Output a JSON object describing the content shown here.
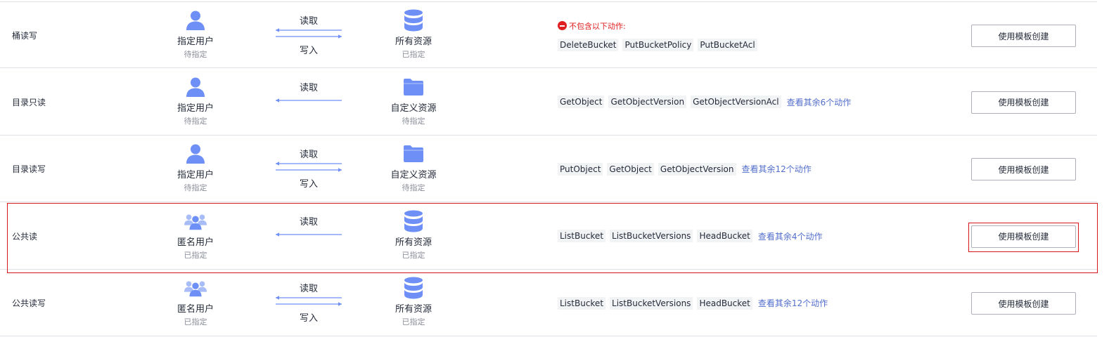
{
  "colors": {
    "accent": "#526ecc",
    "icon": "#6e8ff5",
    "danger": "#e02020",
    "highlight": "#d9161c"
  },
  "rows": [
    {
      "name": "桶读写",
      "principal": {
        "icon": "user-icon",
        "title": "指定用户",
        "status": "待指定"
      },
      "read_label": "读取",
      "write_label": "写入",
      "resource": {
        "icon": "database-icon",
        "title": "所有资源",
        "status": "已指定"
      },
      "exclude_label": "不包含以下动作:",
      "tags": [
        "DeleteBucket",
        "PutBucketPolicy",
        "PutBucketAcl"
      ],
      "more": "",
      "button": "使用模板创建"
    },
    {
      "name": "目录只读",
      "principal": {
        "icon": "user-icon",
        "title": "指定用户",
        "status": "待指定"
      },
      "read_label": "读取",
      "write_label": "",
      "resource": {
        "icon": "folder-icon",
        "title": "自定义资源",
        "status": "待指定"
      },
      "exclude_label": "",
      "tags": [
        "GetObject",
        "GetObjectVersion",
        "GetObjectVersionAcl"
      ],
      "more": "查看其余6个动作",
      "button": "使用模板创建"
    },
    {
      "name": "目录读写",
      "principal": {
        "icon": "user-icon",
        "title": "指定用户",
        "status": "待指定"
      },
      "read_label": "读取",
      "write_label": "写入",
      "resource": {
        "icon": "folder-icon",
        "title": "自定义资源",
        "status": "待指定"
      },
      "exclude_label": "",
      "tags": [
        "PutObject",
        "GetObject",
        "GetObjectVersion"
      ],
      "more": "查看其余12个动作",
      "button": "使用模板创建"
    },
    {
      "name": "公共读",
      "principal": {
        "icon": "anonymous-users-icon",
        "title": "匿名用户",
        "status": "已指定"
      },
      "read_label": "读取",
      "write_label": "",
      "resource": {
        "icon": "database-icon",
        "title": "所有资源",
        "status": "已指定"
      },
      "exclude_label": "",
      "tags": [
        "ListBucket",
        "ListBucketVersions",
        "HeadBucket"
      ],
      "more": "查看其余4个动作",
      "button": "使用模板创建"
    },
    {
      "name": "公共读写",
      "principal": {
        "icon": "anonymous-users-icon",
        "title": "匿名用户",
        "status": "已指定"
      },
      "read_label": "读取",
      "write_label": "写入",
      "resource": {
        "icon": "database-icon",
        "title": "所有资源",
        "status": "已指定"
      },
      "exclude_label": "",
      "tags": [
        "ListBucket",
        "ListBucketVersions",
        "HeadBucket"
      ],
      "more": "查看其余12个动作",
      "button": "使用模板创建"
    }
  ]
}
